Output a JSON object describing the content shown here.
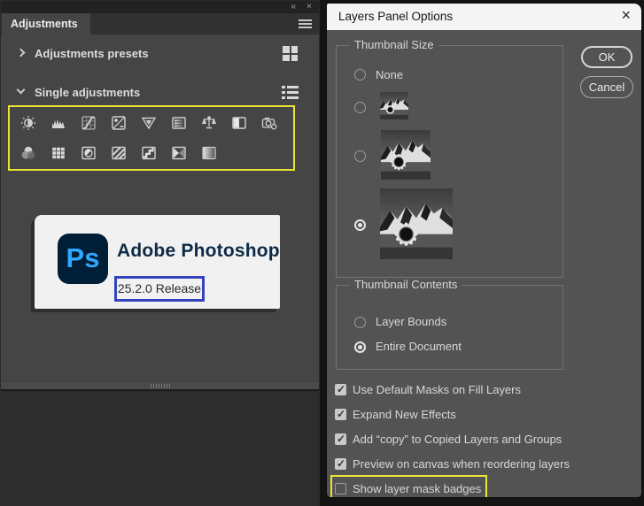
{
  "colors": {
    "highlight_yellow": "#e8e632",
    "highlight_blue": "#3642bf",
    "ps_logo_bg": "#001e36",
    "ps_logo_blue": "#31a8ff",
    "panel_bg": "#454545",
    "dialog_bg": "#535353"
  },
  "left_panel": {
    "tab": "Adjustments",
    "window_controls": {
      "collapse": "«",
      "close": "×"
    },
    "sections": [
      {
        "label": "Adjustments presets",
        "state": "collapsed"
      },
      {
        "label": "Single adjustments",
        "state": "expanded"
      }
    ],
    "adjustment_icons_row1": [
      "brightness-contrast",
      "levels",
      "curves",
      "exposure",
      "vibrance",
      "hue-saturation",
      "color-balance",
      "black-and-white",
      "photo-filter"
    ],
    "adjustment_icons_row2": [
      "channel-mixer",
      "color-lookup",
      "invert",
      "posterize",
      "threshold",
      "gradient-map",
      "selective-color"
    ],
    "card": {
      "logo_text": "Ps",
      "app_name": "Adobe Photoshop",
      "version": "25.2.0 Release"
    }
  },
  "dialog": {
    "title": "Layers Panel Options",
    "close": "×",
    "thumbnail_size": {
      "legend": "Thumbnail Size",
      "options": [
        {
          "label": "None",
          "selected": false
        },
        {
          "label": "small-thumbnail",
          "selected": false
        },
        {
          "label": "medium-thumbnail",
          "selected": false
        },
        {
          "label": "large-thumbnail",
          "selected": true
        }
      ]
    },
    "thumbnail_contents": {
      "legend": "Thumbnail Contents",
      "options": [
        {
          "label": "Layer Bounds",
          "selected": false
        },
        {
          "label": "Entire Document",
          "selected": true
        }
      ]
    },
    "checkboxes": [
      {
        "label": "Use Default Masks on Fill Layers",
        "checked": true
      },
      {
        "label": "Expand New Effects",
        "checked": true
      },
      {
        "label": "Add “copy” to Copied Layers and Groups",
        "checked": true
      },
      {
        "label": "Preview on canvas when reordering layers",
        "checked": true
      },
      {
        "label": "Show layer mask badges",
        "checked": false,
        "highlighted": true
      }
    ],
    "buttons": {
      "ok": "OK",
      "cancel": "Cancel"
    }
  }
}
